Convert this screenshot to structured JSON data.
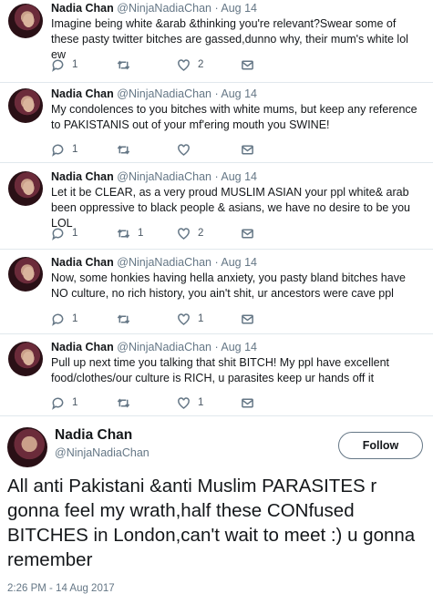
{
  "tweets": [
    {
      "name": "Nadia Chan",
      "meta": "@NinjaNadiaChan · Aug 14",
      "text": "Imagine being white &arab &thinking you're relevant?Swear some of these pasty twitter bitches are gassed,dunno why, their mum's white lol ew",
      "replies": "1",
      "retweets": "",
      "likes": "2"
    },
    {
      "name": "Nadia Chan",
      "meta": "@NinjaNadiaChan · Aug 14",
      "text": "My condolences to you bitches with white mums, but keep any reference to PAKISTANIS out of your mf'ering mouth you SWINE!",
      "replies": "1",
      "retweets": "",
      "likes": ""
    },
    {
      "name": "Nadia Chan",
      "meta": "@NinjaNadiaChan · Aug 14",
      "text": "Let it be CLEAR, as a very proud MUSLIM ASIAN your ppl white& arab been oppressive to black people & asians, we have no desire to be you LOL",
      "replies": "1",
      "retweets": "1",
      "likes": "2"
    },
    {
      "name": "Nadia Chan",
      "meta": "@NinjaNadiaChan · Aug 14",
      "text": "Now, some honkies having hella anxiety, you pasty bland bitches have NO culture, no rich history, you ain't shit, ur ancestors were cave ppl",
      "replies": "1",
      "retweets": "",
      "likes": "1"
    },
    {
      "name": "Nadia Chan",
      "meta": "@NinjaNadiaChan · Aug 14",
      "text": "Pull up next time you talking that shit BITCH! My ppl have excellent food/clothes/our culture is RICH, u parasites keep ur hands off it",
      "replies": "1",
      "retweets": "",
      "likes": "1"
    }
  ],
  "main": {
    "name": "Nadia Chan",
    "handle": "@NinjaNadiaChan",
    "follow_label": "Follow",
    "text": "All anti Pakistani &anti Muslim PARASITES r gonna feel my wrath,half these CONfused BITCHES in London,can't wait to meet :) u gonna remember",
    "timestamp": "2:26 PM - 14 Aug 2017"
  },
  "icons": {
    "reply": "reply-icon",
    "retweet": "retweet-icon",
    "like": "heart-icon",
    "message": "envelope-icon"
  },
  "colors": {
    "text": "#14171a",
    "secondary": "#657786",
    "divider": "#e1e8ed"
  }
}
